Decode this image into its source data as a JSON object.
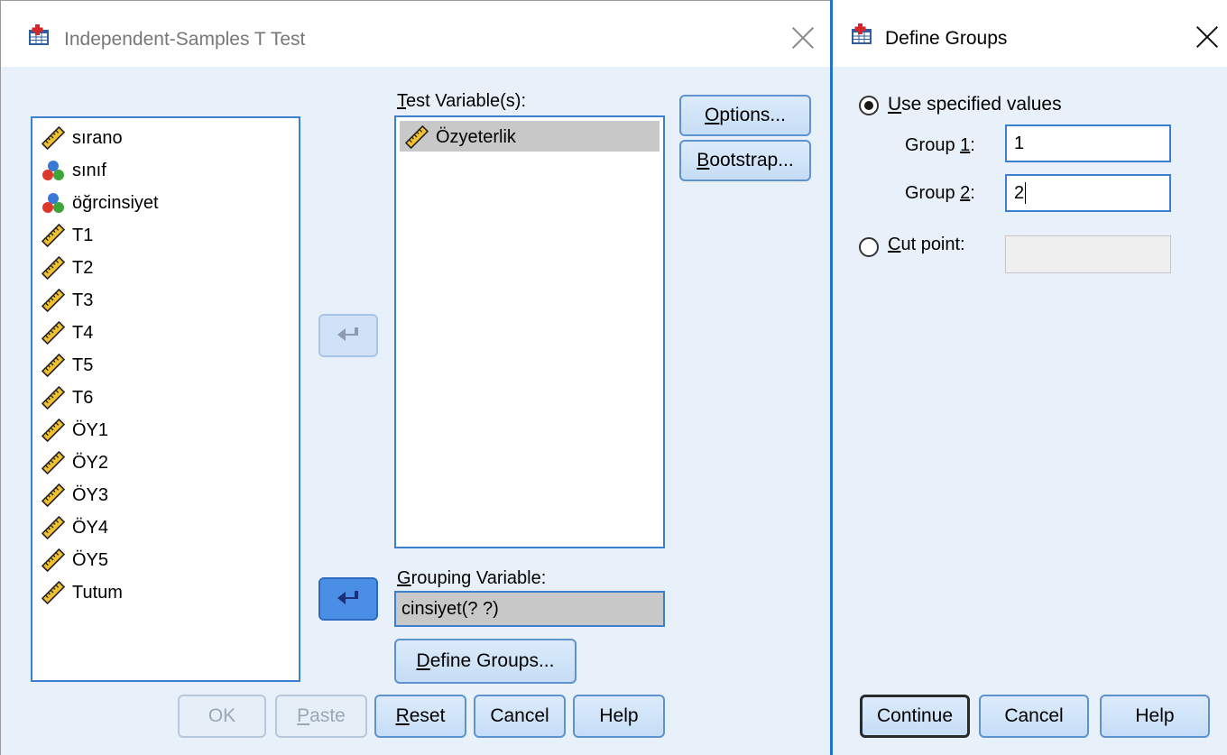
{
  "main_dialog": {
    "title": "Independent-Samples T Test",
    "source_variables": [
      {
        "name": "sırano",
        "type": "scale"
      },
      {
        "name": "sınıf",
        "type": "nominal"
      },
      {
        "name": "öğrcinsiyet",
        "type": "nominal"
      },
      {
        "name": "T1",
        "type": "scale"
      },
      {
        "name": "T2",
        "type": "scale"
      },
      {
        "name": "T3",
        "type": "scale"
      },
      {
        "name": "T4",
        "type": "scale"
      },
      {
        "name": "T5",
        "type": "scale"
      },
      {
        "name": "T6",
        "type": "scale"
      },
      {
        "name": "ÖY1",
        "type": "scale"
      },
      {
        "name": "ÖY2",
        "type": "scale"
      },
      {
        "name": "ÖY3",
        "type": "scale"
      },
      {
        "name": "ÖY4",
        "type": "scale"
      },
      {
        "name": "ÖY5",
        "type": "scale"
      },
      {
        "name": "Tutum",
        "type": "scale"
      }
    ],
    "test_variables_label": "Test Variable(s):",
    "test_variables": [
      {
        "name": "Özyeterlik",
        "type": "scale",
        "selected": true
      }
    ],
    "grouping_variable_label": "Grouping Variable:",
    "grouping_variable_value": "cinsiyet(? ?)",
    "options_button": "Options...",
    "bootstrap_button": "Bootstrap...",
    "define_groups_button": "Define Groups...",
    "buttons": {
      "ok": "OK",
      "paste": "Paste",
      "reset": "Reset",
      "cancel": "Cancel",
      "help": "Help"
    }
  },
  "define_groups_dialog": {
    "title": "Define Groups",
    "use_specified_values_label": "Use specified values",
    "use_specified_values_checked": true,
    "group1_label": "Group 1:",
    "group1_value": "1",
    "group2_label": "Group 2:",
    "group2_value": "2",
    "cut_point_label": "Cut point:",
    "cut_point_value": "",
    "buttons": {
      "continue": "Continue",
      "cancel": "Cancel",
      "help": "Help"
    }
  },
  "colors": {
    "dialog_background": "#e8f1fa",
    "button_border": "#5f93cf",
    "list_border": "#3c7fd0",
    "selection": "#c8c8c8",
    "focus_border": "#1f72d6"
  },
  "icons": {
    "app": "spss-table-icon",
    "scale_variable": "ruler-icon",
    "nominal_variable": "three-balls-icon",
    "move": "curved-arrow-icon"
  }
}
